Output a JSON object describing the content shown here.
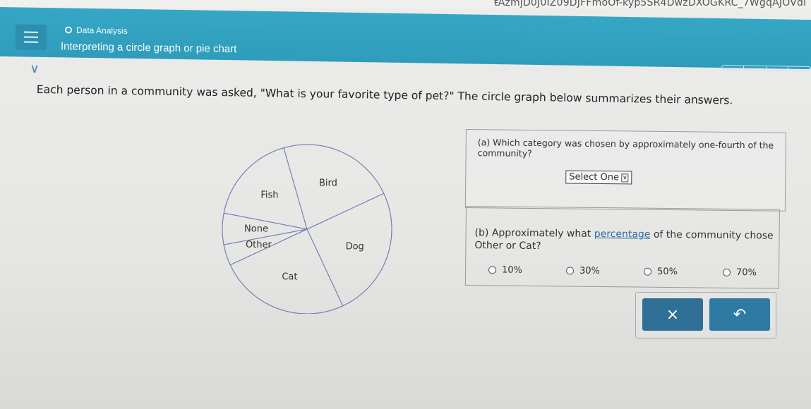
{
  "browser": {
    "url_fragment": "ŧAzmjD0J0IZ09DJFFmoOf-kyp5SR4DwzDXOGKRC_7WgqAJOVdl"
  },
  "header": {
    "menu_icon": "hamburger-icon",
    "topic": "Data Analysis",
    "lesson_title": "Interpreting a circle graph or pie chart",
    "colors": {
      "bar": "#33a3c1",
      "button": "#2c8fb0"
    }
  },
  "collapse": {
    "icon": "chevron-down-icon",
    "glyph": "∨"
  },
  "question": {
    "text": "Each person in a community was asked, \"What is your favorite type of pet?\" The circle graph below summarizes their answers."
  },
  "chart_data": {
    "type": "pie",
    "categories": [
      "Bird",
      "Dog",
      "Cat",
      "Other",
      "None",
      "Fish"
    ],
    "values": [
      22.5,
      25,
      25,
      4,
      6,
      17.5
    ],
    "unit": "percent (estimated from slice angles)"
  },
  "part_a": {
    "question": "(a) Which category was chosen by approximately one-fourth of the community?",
    "select_label": "Select One",
    "select_icon": "chevron-down-icon"
  },
  "part_b": {
    "question_prefix": "(b) Approximately what ",
    "question_link": "percentage",
    "question_suffix": " of the community chose Other or Cat?",
    "options": [
      "10%",
      "30%",
      "50%",
      "70%"
    ]
  },
  "actions": {
    "clear_glyph": "×",
    "clear_icon": "close-icon",
    "undo_glyph": "↶",
    "undo_icon": "undo-icon",
    "color": "#2f6f96"
  }
}
